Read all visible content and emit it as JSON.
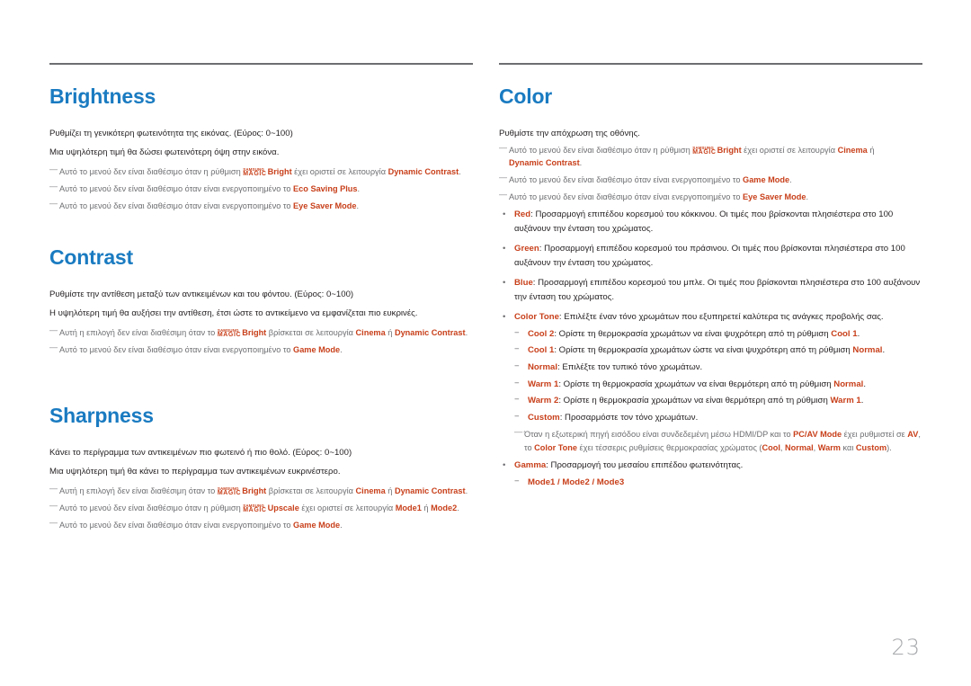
{
  "page_number": "23",
  "magic_logo": {
    "top": "SAMSUNG",
    "bottom": "MAGIC"
  },
  "brightness": {
    "title": "Brightness",
    "desc1": "Ρυθμίζει τη γενικότερη φωτεινότητα της εικόνας. (Εύρος: 0~100)",
    "desc2": "Μια υψηλότερη τιμή θα δώσει φωτεινότερη όψη στην εικόνα.",
    "note1": {
      "pre": "Αυτό το μενού δεν είναι διαθέσιμο όταν η ρύθμιση ",
      "kw1": "Bright",
      "mid": " έχει οριστεί σε λειτουργία ",
      "kw2": "Dynamic Contrast",
      "post": "."
    },
    "note2": {
      "pre": "Αυτό το μενού δεν είναι διαθέσιμο όταν είναι ενεργοποιημένο το ",
      "kw": "Eco Saving Plus",
      "post": "."
    },
    "note3": {
      "pre": "Αυτό το μενού δεν είναι διαθέσιμο όταν είναι ενεργοποιημένο το ",
      "kw": "Eye Saver Mode",
      "post": "."
    }
  },
  "contrast": {
    "title": "Contrast",
    "desc1": "Ρυθμίστε την αντίθεση μεταξύ των αντικειμένων και του φόντου. (Εύρος: 0~100)",
    "desc2": "Η υψηλότερη τιμή θα αυξήσει την αντίθεση, έτσι ώστε το αντικείμενο να εμφανίζεται πιο ευκρινές.",
    "note1": {
      "pre": "Αυτή η επιλογή δεν είναι διαθέσιμη όταν το ",
      "kw1": "Bright",
      "mid": " βρίσκεται σε λειτουργία ",
      "kw2": "Cinema",
      "or": " ή ",
      "kw3": "Dynamic Contrast",
      "post": "."
    },
    "note2": {
      "pre": "Αυτό το μενού δεν είναι διαθέσιμο όταν είναι ενεργοποιημένο το ",
      "kw": "Game Mode",
      "post": "."
    }
  },
  "sharpness": {
    "title": "Sharpness",
    "desc1": "Κάνει το περίγραμμα των αντικειμένων πιο φωτεινό ή πιο θολό. (Εύρος: 0~100)",
    "desc2": "Μια υψηλότερη τιμή θα κάνει το περίγραμμα των αντικειμένων ευκρινέστερο.",
    "note1": {
      "pre": "Αυτή η επιλογή δεν είναι διαθέσιμη όταν το ",
      "kw1": "Bright",
      "mid": " βρίσκεται σε λειτουργία ",
      "kw2": "Cinema",
      "or": " ή ",
      "kw3": "Dynamic Contrast",
      "post": "."
    },
    "note2": {
      "pre": "Αυτό το μενού δεν είναι διαθέσιμο όταν η ρύθμιση ",
      "kw1": "Upscale",
      "mid": " έχει οριστεί σε λειτουργία ",
      "kw2": "Mode1",
      "or": " ή ",
      "kw3": "Mode2",
      "post": "."
    },
    "note3": {
      "pre": "Αυτό το μενού δεν είναι διαθέσιμο όταν είναι ενεργοποιημένο το ",
      "kw": "Game Mode",
      "post": "."
    }
  },
  "color": {
    "title": "Color",
    "desc1": "Ρυθμίστε την απόχρωση της οθόνης.",
    "note1": {
      "pre": "Αυτό το μενού δεν είναι διαθέσιμο όταν η ρύθμιση ",
      "kw1": "Bright",
      "mid": " έχει οριστεί σε λειτουργία ",
      "kw2": "Cinema",
      "or": " ή ",
      "kw3": "Dynamic Contrast",
      "post": "."
    },
    "note2": {
      "pre": "Αυτό το μενού δεν είναι διαθέσιμο όταν είναι ενεργοποιημένο το ",
      "kw": "Game Mode",
      "post": "."
    },
    "note3": {
      "pre": "Αυτό το μενού δεν είναι διαθέσιμο όταν είναι ενεργοποιημένο το ",
      "kw": "Eye Saver Mode",
      "post": "."
    },
    "red": {
      "kw": "Red",
      "text": ": Προσαρμογή επιπέδου κορεσμού του κόκκινου. Οι τιμές που βρίσκονται πλησιέστερα στο 100 αυξάνουν την ένταση του χρώματος."
    },
    "green": {
      "kw": "Green",
      "text": ": Προσαρμογή επιπέδου κορεσμού του πράσινου. Οι τιμές που βρίσκονται πλησιέστερα στο 100 αυξάνουν την ένταση του χρώματος."
    },
    "blue": {
      "kw": "Blue",
      "text": ": Προσαρμογή επιπέδου κορεσμού του μπλε. Οι τιμές που βρίσκονται πλησιέστερα στο 100 αυξάνουν την ένταση του χρώματος."
    },
    "tone": {
      "kw": "Color Tone",
      "text": ": Επιλέξτε έναν τόνο χρωμάτων που εξυπηρετεί καλύτερα τις ανάγκες προβολής σας.",
      "items": [
        {
          "kw": "Cool 2",
          "text": ": Ορίστε τη θερμοκρασία χρωμάτων να είναι ψυχρότερη από τη ρύθμιση ",
          "ref": "Cool 1",
          "post": "."
        },
        {
          "kw": "Cool 1",
          "text": ": Ορίστε τη θερμοκρασία χρωμάτων ώστε να είναι ψυχρότερη από τη ρύθμιση ",
          "ref": "Normal",
          "post": "."
        },
        {
          "kw": "Normal",
          "text": ": Επιλέξτε τον τυπικό τόνο χρωμάτων.",
          "ref": "",
          "post": ""
        },
        {
          "kw": "Warm 1",
          "text": ": Ορίστε τη θερμοκρασία χρωμάτων να είναι θερμότερη από τη ρύθμιση ",
          "ref": "Normal",
          "post": "."
        },
        {
          "kw": "Warm 2",
          "text": ": Ορίστε η θερμοκρασία χρωμάτων να είναι θερμότερη από τη ρύθμιση ",
          "ref": "Warm 1",
          "post": "."
        },
        {
          "kw": "Custom",
          "text": ": Προσαρμόστε τον τόνο χρωμάτων.",
          "ref": "",
          "post": ""
        }
      ],
      "note": {
        "a": "Όταν η εξωτερική πηγή εισόδου είναι συνδεδεμένη μέσω HDMI/DP και το ",
        "kw1": "PC/AV Mode",
        "b": " έχει ρυθμιστεί σε ",
        "kw2": "AV",
        "c": ", το ",
        "kw3": "Color Tone",
        "d": " έχει τέσσερις ρυθμίσεις θερμοκρασίας χρώματος (",
        "kw4": "Cool",
        "e": ", ",
        "kw5": "Normal",
        "f": ", ",
        "kw6": "Warm",
        "g": " και ",
        "kw7": "Custom",
        "h": ")."
      }
    },
    "gamma": {
      "kw": "Gamma",
      "text": ": Προσαρμογή του μεσαίου επιπέδου φωτεινότητας.",
      "m1": "Mode1",
      "sep": " / ",
      "m2": "Mode2",
      "m3": "Mode3"
    }
  }
}
